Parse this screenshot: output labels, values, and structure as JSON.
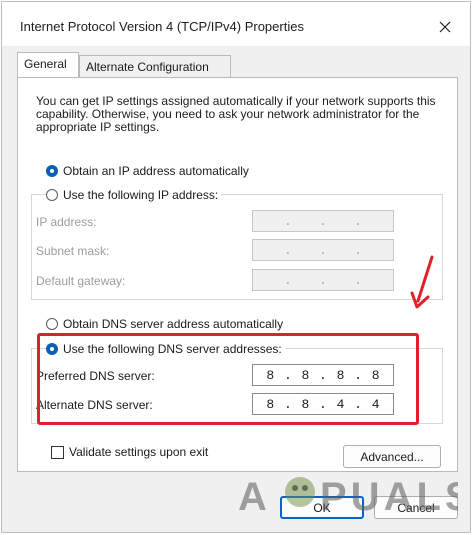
{
  "window": {
    "title": "Internet Protocol Version 4 (TCP/IPv4) Properties",
    "close_icon": "close-icon"
  },
  "tabs": [
    {
      "label": "General",
      "active": true
    },
    {
      "label": "Alternate Configuration",
      "active": false
    }
  ],
  "description": "You can get IP settings assigned automatically if your network supports this capability. Otherwise, you need to ask your network administrator for the appropriate IP settings.",
  "ip_section": {
    "auto_label": "Obtain an IP address automatically",
    "auto_checked": true,
    "manual_label": "Use the following IP address:",
    "manual_checked": false,
    "fields": [
      {
        "label": "IP address:",
        "value": [
          " ",
          " ",
          " ",
          " "
        ]
      },
      {
        "label": "Subnet mask:",
        "value": [
          " ",
          " ",
          " ",
          " "
        ]
      },
      {
        "label": "Default gateway:",
        "value": [
          " ",
          " ",
          " ",
          " "
        ]
      }
    ]
  },
  "dns_section": {
    "auto_label": "Obtain DNS server address automatically",
    "auto_checked": false,
    "manual_label": "Use the following DNS server addresses:",
    "manual_checked": true,
    "preferred": {
      "label": "Preferred DNS server:",
      "octets": [
        "8",
        "8",
        "8",
        "8"
      ]
    },
    "alternate": {
      "label": "Alternate DNS server:",
      "octets": [
        "8",
        "8",
        "4",
        "4"
      ]
    }
  },
  "validate": {
    "label": "Validate settings upon exit",
    "checked": false
  },
  "buttons": {
    "advanced": "Advanced...",
    "ok": "OK",
    "cancel": "Cancel"
  },
  "watermark": {
    "text": "APPUALS"
  },
  "colors": {
    "accent": "#0a5fb4",
    "highlight": "#e0202b"
  }
}
